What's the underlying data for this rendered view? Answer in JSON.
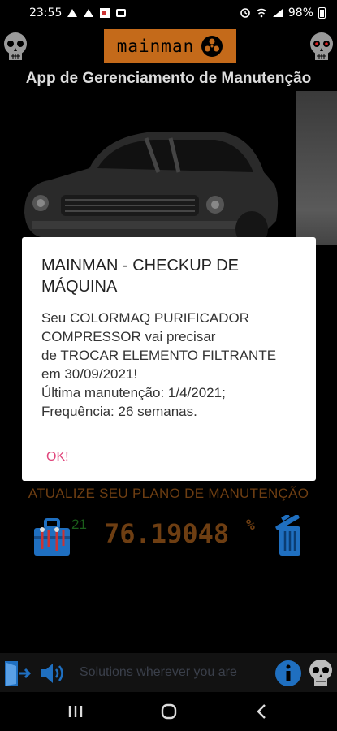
{
  "status_bar": {
    "time": "23:55",
    "battery": "98%"
  },
  "header": {
    "logo_text": "mainman",
    "subtitle": "App de Gerenciamento de Manutenção"
  },
  "dialog": {
    "title": "MAINMAN - CHECKUP DE MÁQUINA",
    "message": "Seu COLORMAQ PURIFICADOR COMPRESSOR vai precisar\nde TROCAR ELEMENTO FILTRANTE em 30/09/2021!\nÚltima manutenção: 1/4/2021;\nFrequência: 26 semanas.",
    "ok_label": "OK!"
  },
  "plan": {
    "banner": "ATUALIZE SEU PLANO DE MANUTENÇÃO",
    "tool_count": "21",
    "percent": "76.19048",
    "percent_sign": "%"
  },
  "bottom": {
    "tagline": "Solutions wherever you are"
  },
  "colors": {
    "accent_orange": "#c46a1a",
    "dialog_button": "#e0457b",
    "icon_blue": "#1f7bd6"
  }
}
